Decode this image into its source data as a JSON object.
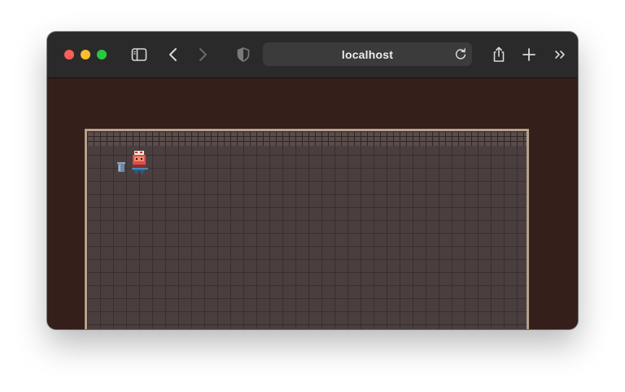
{
  "browser": {
    "address_bar": {
      "url": "localhost"
    },
    "icons": [
      "sidebar-icon",
      "back-icon",
      "forward-icon",
      "privacy-shield-icon",
      "reload-icon",
      "share-icon",
      "new-tab-icon",
      "more-icon"
    ]
  },
  "page": {
    "background_color": "#341f1a",
    "game": {
      "floor_color": "#4a3e3f",
      "border_color": "#b8a08c",
      "sprites": [
        "player-character",
        "trash-bin"
      ]
    }
  }
}
